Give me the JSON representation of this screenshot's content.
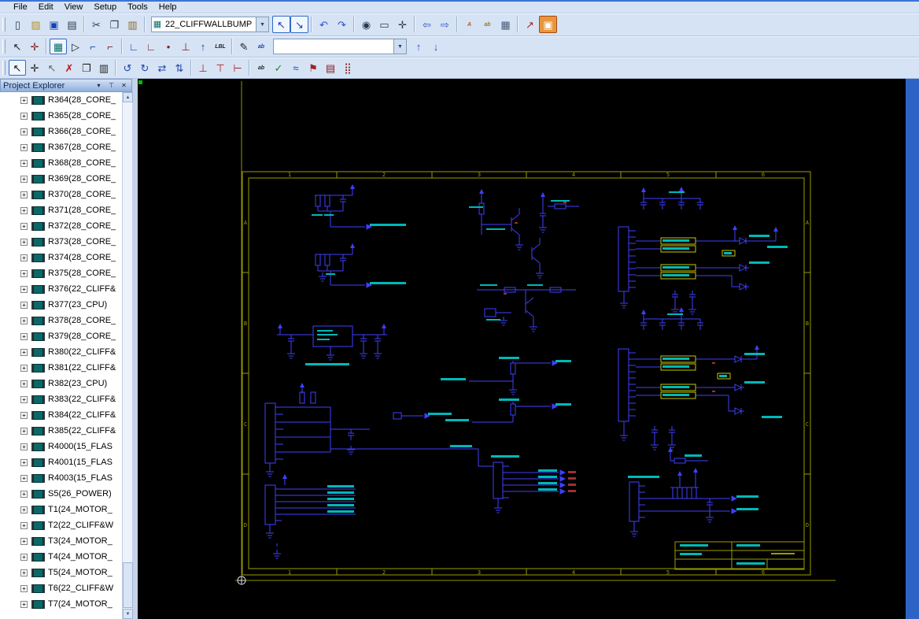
{
  "menu": {
    "items": [
      {
        "label": "File"
      },
      {
        "label": "Edit"
      },
      {
        "label": "View"
      },
      {
        "label": "Setup"
      },
      {
        "label": "Tools"
      },
      {
        "label": "Help"
      }
    ]
  },
  "glyphs": {
    "panel_menu": "▾",
    "pin": "⊤",
    "close": "✕",
    "scroll_up": "▲",
    "scroll_down": "▼",
    "dropdown": "▼",
    "nav_up": "↑",
    "nav_down": "↓",
    "expand": "+",
    "sheet_icon": "▦"
  },
  "toolbar_standard": {
    "sheet_selector_value": "22_CLIFFWALLBUMP",
    "icons_left": [
      {
        "n": "new-icon",
        "g": "▯",
        "c": "#2a3a55"
      },
      {
        "n": "open-icon",
        "g": "▨",
        "c": "#b8912a"
      },
      {
        "n": "save-icon",
        "g": "▣",
        "c": "#1a3fae"
      },
      {
        "n": "print-icon",
        "g": "▤",
        "c": "#2a3a55"
      },
      {
        "sep": true
      },
      {
        "n": "cut-icon",
        "g": "✂",
        "c": "#2a3a55"
      },
      {
        "n": "copy-icon",
        "g": "❐",
        "c": "#2a3a55"
      },
      {
        "n": "paste-icon",
        "g": "▥",
        "c": "#8a6a2a"
      },
      {
        "sep": true
      }
    ],
    "icons_right": [
      {
        "n": "select-arrow-icon",
        "g": "↖",
        "c": "#1a3fae",
        "pressed": true
      },
      {
        "n": "select-area-icon",
        "g": "↘",
        "c": "#1a3fae",
        "pressed": true
      },
      {
        "sep": true
      },
      {
        "n": "undo-icon",
        "g": "↶",
        "c": "#2a52c9"
      },
      {
        "n": "redo-icon",
        "g": "↷",
        "c": "#2a52c9"
      },
      {
        "sep": true
      },
      {
        "n": "zoom-icon",
        "g": "◉",
        "c": "#2a3a55"
      },
      {
        "n": "zoom-fit-icon",
        "g": "▭",
        "c": "#2a3a55"
      },
      {
        "n": "pan-icon",
        "g": "✛",
        "c": "#2a3a55"
      },
      {
        "sep": true
      },
      {
        "n": "previous-sheet-icon",
        "g": "⇦",
        "c": "#2a52c9"
      },
      {
        "n": "next-sheet-icon",
        "g": "⇨",
        "c": "#2a52c9"
      },
      {
        "sep": true
      },
      {
        "n": "annotate-icon",
        "g": "A",
        "c": "#b4541c",
        "small": true
      },
      {
        "n": "attribute-display-icon",
        "g": "ab",
        "c": "#9a7a1a",
        "small": true
      },
      {
        "n": "grid-icon",
        "g": "▦",
        "c": "#4a5a75"
      },
      {
        "sep": true
      },
      {
        "n": "export-icon",
        "g": "↗",
        "c": "#a22a2a"
      },
      {
        "n": "reports-icon",
        "g": "▣",
        "c": "#ffffff",
        "boxed": true
      }
    ]
  },
  "toolbar_add": {
    "combo_value": "",
    "icons": [
      {
        "n": "pointer-icon",
        "g": "↖",
        "c": "#222222"
      },
      {
        "n": "pick-icon",
        "g": "✛",
        "c": "#8a1a1a"
      },
      {
        "sep": true
      },
      {
        "n": "add-component-icon",
        "g": "▦",
        "c": "#0a6b6b",
        "pressed": true
      },
      {
        "n": "add-symbol-icon",
        "g": "▷",
        "c": "#222222"
      },
      {
        "n": "add-wire-icon",
        "g": "⌐",
        "c": "#1a44aa"
      },
      {
        "n": "add-bus-icon",
        "g": "⌐",
        "c": "#8a1a1a"
      },
      {
        "sep": true
      },
      {
        "n": "wire-corner-icon",
        "g": "∟",
        "c": "#1a44aa"
      },
      {
        "n": "bus-corner-icon",
        "g": "∟",
        "c": "#8a1a1a"
      },
      {
        "n": "add-junction-icon",
        "g": "•",
        "c": "#8a1a1a"
      },
      {
        "n": "add-terminal-icon",
        "g": "⊥",
        "c": "#8a1a1a"
      },
      {
        "n": "add-power-icon",
        "g": "↑",
        "c": "#1a44aa"
      },
      {
        "n": "add-label-icon",
        "g": "LBL",
        "c": "#222222",
        "small": true
      },
      {
        "sep": true
      },
      {
        "n": "draw-icon",
        "g": "✎",
        "c": "#222222"
      },
      {
        "n": "text-icon",
        "g": "ab",
        "c": "#1a3fae",
        "small": true
      }
    ]
  },
  "toolbar_edit": {
    "icons": [
      {
        "n": "select-mode-icon",
        "g": "↖",
        "c": "#111111",
        "pressed": true
      },
      {
        "n": "move-icon",
        "g": "✛",
        "c": "#222222"
      },
      {
        "n": "drag-icon",
        "g": "↖",
        "c": "#666666"
      },
      {
        "n": "delete-icon",
        "g": "✗",
        "c": "#c01010"
      },
      {
        "n": "duplicate-icon",
        "g": "❐",
        "c": "#222222"
      },
      {
        "n": "properties-icon",
        "g": "▥",
        "c": "#222222"
      },
      {
        "sep": true
      },
      {
        "n": "rotate-left-icon",
        "g": "↺",
        "c": "#1a44aa"
      },
      {
        "n": "rotate-right-icon",
        "g": "↻",
        "c": "#1a44aa"
      },
      {
        "n": "mirror-horizontal-icon",
        "g": "⇄",
        "c": "#1a44aa"
      },
      {
        "n": "mirror-vertical-icon",
        "g": "⇅",
        "c": "#1a44aa"
      },
      {
        "sep": true
      },
      {
        "n": "connect-icon",
        "g": "⊥",
        "c": "#b02020"
      },
      {
        "n": "disconnect-icon",
        "g": "⊤",
        "c": "#b02020"
      },
      {
        "n": "reconnect-icon",
        "g": "⊢",
        "c": "#b02020"
      },
      {
        "sep": true
      },
      {
        "n": "net-name-icon",
        "g": "ab",
        "c": "#222222",
        "small": true
      },
      {
        "n": "check-icon",
        "g": "✓",
        "c": "#1a8a1a"
      },
      {
        "n": "signals-icon",
        "g": "≈",
        "c": "#1a44aa"
      },
      {
        "n": "flag-icon",
        "g": "⚑",
        "c": "#a02020"
      },
      {
        "n": "error-log-icon",
        "g": "▤",
        "c": "#8a1a1a"
      },
      {
        "n": "debug-icon",
        "g": "⣿",
        "c": "#8a1a1a"
      }
    ]
  },
  "project_explorer": {
    "title": "Project Explorer",
    "items": [
      "R364(28_CORE_",
      "R365(28_CORE_",
      "R366(28_CORE_",
      "R367(28_CORE_",
      "R368(28_CORE_",
      "R369(28_CORE_",
      "R370(28_CORE_",
      "R371(28_CORE_",
      "R372(28_CORE_",
      "R373(28_CORE_",
      "R374(28_CORE_",
      "R375(28_CORE_",
      "R376(22_CLIFF&",
      "R377(23_CPU)",
      "R378(28_CORE_",
      "R379(28_CORE_",
      "R380(22_CLIFF&",
      "R381(22_CLIFF&",
      "R382(23_CPU)",
      "R383(22_CLIFF&",
      "R384(22_CLIFF&",
      "R385(22_CLIFF&",
      "R4000(15_FLAS",
      "R4001(15_FLAS",
      "R4003(15_FLAS",
      "S5(26_POWER)",
      "T1(24_MOTOR_",
      "T2(22_CLIFF&W",
      "T3(24_MOTOR_",
      "T4(24_MOTOR_",
      "T5(24_MOTOR_",
      "T6(22_CLIFF&W",
      "T7(24_MOTOR_"
    ]
  },
  "canvas": {
    "zone_cols": [
      "1",
      "2",
      "3",
      "4",
      "5",
      "6"
    ],
    "zone_rows": [
      "A",
      "B",
      "C",
      "D"
    ]
  }
}
